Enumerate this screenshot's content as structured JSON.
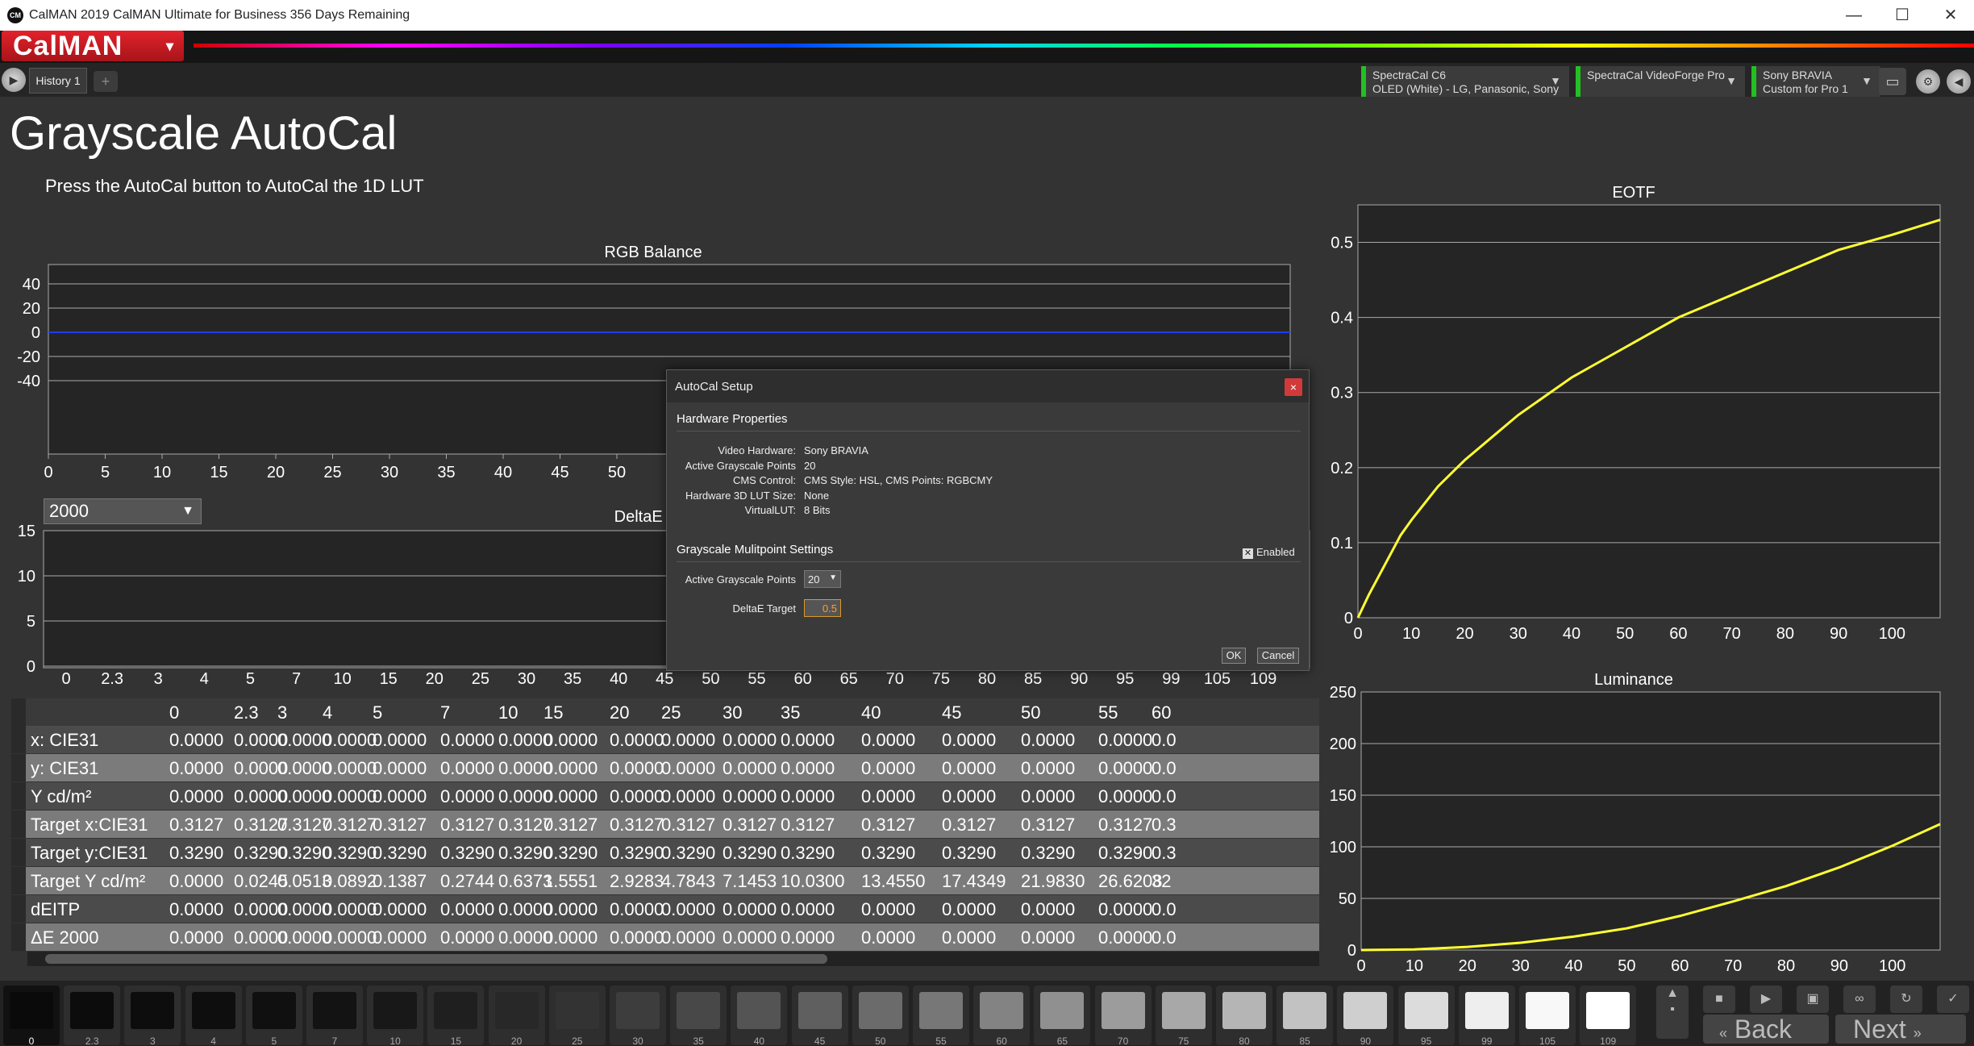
{
  "window": {
    "icon_text": "CM",
    "title": "CalMAN 2019 CalMAN Ultimate for Business 356 Days Remaining",
    "controls": [
      "—",
      "☐",
      "✕"
    ]
  },
  "header": {
    "logo": "CalMAN",
    "tab_label": "History 1",
    "add_tab": "+",
    "devices": [
      {
        "line1": "SpectraCal C6",
        "line2": "OLED (White) - LG, Panasonic, Sony"
      },
      {
        "line1": "SpectraCal VideoForge Pro",
        "line2": ""
      },
      {
        "line1": "Sony BRAVIA",
        "line2": "Custom for Pro 1"
      }
    ]
  },
  "page": {
    "title": "Grayscale AutoCal",
    "instruction": "Press the AutoCal button to AutoCal the 1D LUT"
  },
  "rgb_chart": {
    "title": "RGB Balance",
    "y_ticks": [
      "40",
      "20",
      "0",
      "-20",
      "-40"
    ],
    "x_ticks": [
      "0",
      "5",
      "10",
      "15",
      "20",
      "25",
      "30",
      "35",
      "40",
      "45",
      "50",
      "5"
    ]
  },
  "lut_select": {
    "value": "2000"
  },
  "deltae_chart": {
    "title": "DeltaE 2",
    "y_ticks": [
      "15",
      "10",
      "5",
      "0"
    ],
    "x_ticks": [
      "0",
      "2.3",
      "3",
      "4",
      "5",
      "7",
      "10",
      "15",
      "20",
      "25",
      "30",
      "35",
      "40",
      "45",
      "50",
      "55",
      "60",
      "65",
      "70",
      "75",
      "80",
      "85",
      "90",
      "95",
      "99",
      "105",
      "109"
    ]
  },
  "eotf_chart": {
    "title": "EOTF",
    "y_ticks": [
      "0.5",
      "0.4",
      "0.3",
      "0.2",
      "0.1",
      "0"
    ],
    "x_ticks": [
      "0",
      "10",
      "20",
      "30",
      "40",
      "50",
      "60",
      "70",
      "80",
      "90",
      "100"
    ]
  },
  "luminance_chart": {
    "title": "Luminance",
    "y_ticks": [
      "250",
      "200",
      "150",
      "100",
      "50",
      "0"
    ],
    "x_ticks": [
      "0",
      "10",
      "20",
      "30",
      "40",
      "50",
      "60",
      "70",
      "80",
      "90",
      "100"
    ]
  },
  "chart_data": [
    {
      "type": "line",
      "title": "RGB Balance",
      "ylim": [
        -50,
        50
      ],
      "xlim": [
        0,
        109
      ],
      "series": [
        {
          "x": [
            0,
            109
          ],
          "y": [
            0,
            0
          ],
          "color": "#1f3cff"
        }
      ]
    },
    {
      "type": "line",
      "title": "EOTF",
      "xlim": [
        0,
        109
      ],
      "ylim": [
        0,
        0.55
      ],
      "series": [
        {
          "x": [
            0,
            2,
            5,
            8,
            10,
            15,
            20,
            25,
            30,
            40,
            50,
            60,
            70,
            80,
            90,
            100,
            109
          ],
          "y": [
            0,
            0.03,
            0.07,
            0.11,
            0.13,
            0.175,
            0.21,
            0.24,
            0.27,
            0.32,
            0.36,
            0.4,
            0.43,
            0.46,
            0.49,
            0.51,
            0.53
          ],
          "color": "#ffff33"
        }
      ]
    },
    {
      "type": "line",
      "title": "Luminance",
      "xlim": [
        0,
        109
      ],
      "ylim": [
        0,
        250
      ],
      "series": [
        {
          "x": [
            0,
            10,
            20,
            30,
            40,
            50,
            60,
            70,
            80,
            90,
            100,
            109
          ],
          "y": [
            0,
            0.6,
            3,
            7,
            13,
            21,
            33,
            47,
            62,
            80,
            101,
            122
          ],
          "color": "#ffff33"
        }
      ]
    }
  ],
  "table": {
    "columns": [
      "0",
      "2.3",
      "3",
      "4",
      "5",
      "7",
      "10",
      "15",
      "20",
      "25",
      "30",
      "35",
      "40",
      "45",
      "50",
      "55",
      "60"
    ],
    "rows": [
      {
        "label": "x: CIE31",
        "values": [
          "0.0000",
          "0.0000",
          "0.0000",
          "0.0000",
          "0.0000",
          "0.0000",
          "0.0000",
          "0.0000",
          "0.0000",
          "0.0000",
          "0.0000",
          "0.0000",
          "0.0000",
          "0.0000",
          "0.0000",
          "0.0000",
          "0.0"
        ]
      },
      {
        "label": "y: CIE31",
        "values": [
          "0.0000",
          "0.0000",
          "0.0000",
          "0.0000",
          "0.0000",
          "0.0000",
          "0.0000",
          "0.0000",
          "0.0000",
          "0.0000",
          "0.0000",
          "0.0000",
          "0.0000",
          "0.0000",
          "0.0000",
          "0.0000",
          "0.0"
        ]
      },
      {
        "label": "Y cd/m²",
        "values": [
          "0.0000",
          "0.0000",
          "0.0000",
          "0.0000",
          "0.0000",
          "0.0000",
          "0.0000",
          "0.0000",
          "0.0000",
          "0.0000",
          "0.0000",
          "0.0000",
          "0.0000",
          "0.0000",
          "0.0000",
          "0.0000",
          "0.0"
        ]
      },
      {
        "label": "Target x:CIE31",
        "values": [
          "0.3127",
          "0.3127",
          "0.3127",
          "0.3127",
          "0.3127",
          "0.3127",
          "0.3127",
          "0.3127",
          "0.3127",
          "0.3127",
          "0.3127",
          "0.3127",
          "0.3127",
          "0.3127",
          "0.3127",
          "0.3127",
          "0.3"
        ]
      },
      {
        "label": "Target y:CIE31",
        "values": [
          "0.3290",
          "0.3290",
          "0.3290",
          "0.3290",
          "0.3290",
          "0.3290",
          "0.3290",
          "0.3290",
          "0.3290",
          "0.3290",
          "0.3290",
          "0.3290",
          "0.3290",
          "0.3290",
          "0.3290",
          "0.3290",
          "0.3"
        ]
      },
      {
        "label": "Target Y cd/m²",
        "values": [
          "0.0000",
          "0.0245",
          "0.0513",
          "0.0892",
          "0.1387",
          "0.2744",
          "0.6373",
          "1.5551",
          "2.9283",
          "4.7843",
          "7.1453",
          "10.0300",
          "13.4550",
          "17.4349",
          "21.9830",
          "26.6208",
          "32"
        ]
      },
      {
        "label": "dEITP",
        "values": [
          "0.0000",
          "0.0000",
          "0.0000",
          "0.0000",
          "0.0000",
          "0.0000",
          "0.0000",
          "0.0000",
          "0.0000",
          "0.0000",
          "0.0000",
          "0.0000",
          "0.0000",
          "0.0000",
          "0.0000",
          "0.0000",
          "0.0"
        ]
      },
      {
        "label": "ΔE 2000",
        "values": [
          "0.0000",
          "0.0000",
          "0.0000",
          "0.0000",
          "0.0000",
          "0.0000",
          "0.0000",
          "0.0000",
          "0.0000",
          "0.0000",
          "0.0000",
          "0.0000",
          "0.0000",
          "0.0000",
          "0.0000",
          "0.0000",
          "0.0"
        ]
      }
    ]
  },
  "dialog": {
    "title": "AutoCal Setup",
    "close": "×",
    "hardware_heading": "Hardware Properties",
    "props": [
      {
        "label": "Video Hardware:",
        "value": "Sony BRAVIA"
      },
      {
        "label": "Active Grayscale Points",
        "value": "20"
      },
      {
        "label": "CMS Control:",
        "value": "CMS Style: HSL, CMS Points: RGBCMY"
      },
      {
        "label": "Hardware 3D LUT Size:",
        "value": "None"
      },
      {
        "label": "VirtualLUT:",
        "value": "8 Bits"
      }
    ],
    "multipoint_heading": "Grayscale Mulitpoint Settings",
    "enabled_label": "Enabled",
    "enabled_checked": true,
    "points_label": "Active Grayscale Points",
    "points_value": "20",
    "deltae_label": "DeltaE Target",
    "deltae_value": "0.5",
    "ok": "OK",
    "cancel": "Cancel"
  },
  "patches": [
    {
      "label": "0",
      "gray": "#0a0a0a"
    },
    {
      "label": "2.3",
      "gray": "#0c0c0c"
    },
    {
      "label": "3",
      "gray": "#0d0d0d"
    },
    {
      "label": "4",
      "gray": "#0e0e0e"
    },
    {
      "label": "5",
      "gray": "#101010"
    },
    {
      "label": "7",
      "gray": "#131313"
    },
    {
      "label": "10",
      "gray": "#181818"
    },
    {
      "label": "15",
      "gray": "#1f1f1f"
    },
    {
      "label": "20",
      "gray": "#282828"
    },
    {
      "label": "25",
      "gray": "#333333"
    },
    {
      "label": "30",
      "gray": "#3d3d3d"
    },
    {
      "label": "35",
      "gray": "#484848"
    },
    {
      "label": "40",
      "gray": "#545454"
    },
    {
      "label": "45",
      "gray": "#5f5f5f"
    },
    {
      "label": "50",
      "gray": "#6b6b6b"
    },
    {
      "label": "55",
      "gray": "#777777"
    },
    {
      "label": "60",
      "gray": "#838383"
    },
    {
      "label": "65",
      "gray": "#909090"
    },
    {
      "label": "70",
      "gray": "#9c9c9c"
    },
    {
      "label": "75",
      "gray": "#a8a8a8"
    },
    {
      "label": "80",
      "gray": "#b5b5b5"
    },
    {
      "label": "85",
      "gray": "#c2c2c2"
    },
    {
      "label": "90",
      "gray": "#cfcfcf"
    },
    {
      "label": "95",
      "gray": "#dcdcdc"
    },
    {
      "label": "99",
      "gray": "#eeeeee"
    },
    {
      "label": "105",
      "gray": "#f8f8f8"
    },
    {
      "label": "109",
      "gray": "#ffffff"
    }
  ],
  "nav": {
    "back": "Back",
    "next": "Next"
  }
}
